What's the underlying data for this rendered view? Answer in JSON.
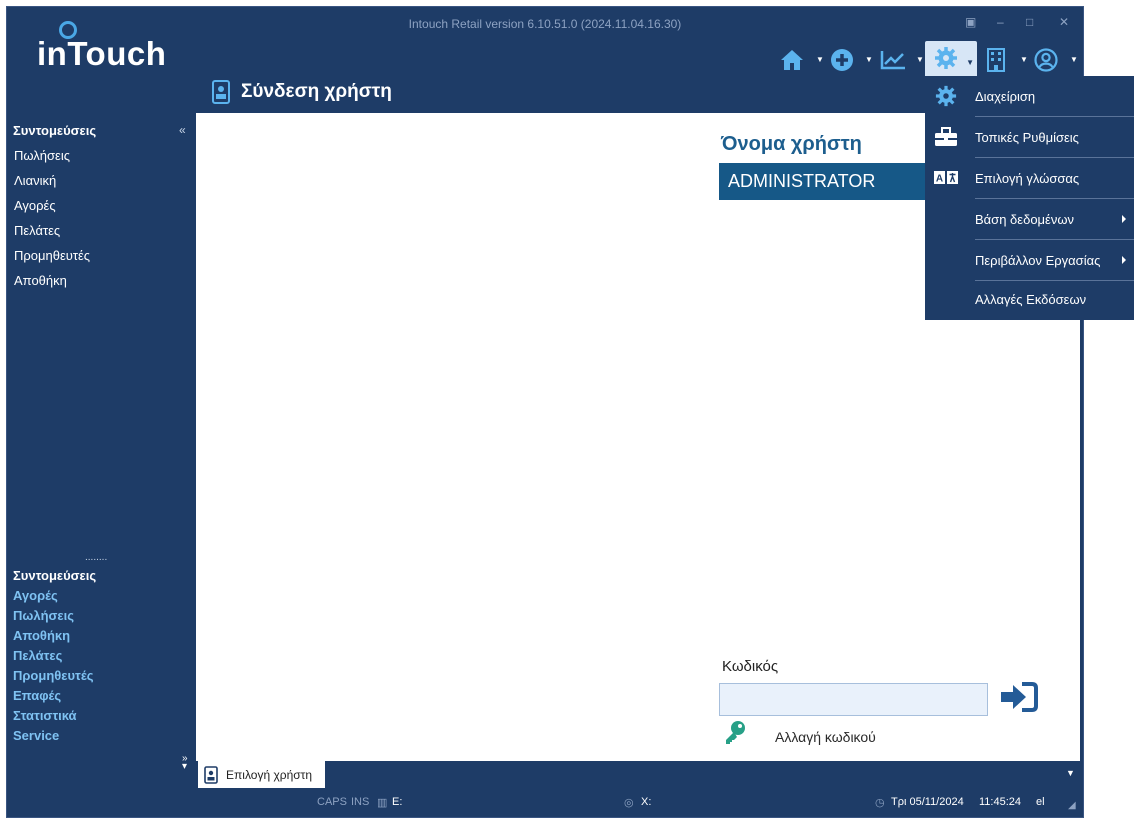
{
  "window": {
    "title": "Intouch Retail version 6.10.51.0 (2024.11.04.16.30)"
  },
  "logo": {
    "text": "inTouch"
  },
  "toolbar": {
    "icons": [
      "home-icon",
      "plus-circle-icon",
      "chart-line-icon",
      "gear-icon",
      "building-icon",
      "user-circle-icon"
    ],
    "active": "gear-icon"
  },
  "page": {
    "title": "Σύνδεση χρήστη"
  },
  "sidebar": {
    "top_heading": "Συντομεύσεις",
    "top_items": [
      "Πωλήσεις",
      "Λιανική",
      "Αγορές",
      "Πελάτες",
      "Προμηθευτές",
      "Αποθήκη"
    ],
    "splitter": "........",
    "bottom_heading": "Συντομεύσεις",
    "bottom_links": [
      "Αγορές",
      "Πωλήσεις",
      "Αποθήκη",
      "Πελάτες",
      "Προμηθευτές",
      "Επαφές",
      "Στατιστικά",
      "Service"
    ]
  },
  "login": {
    "user_label": "Όνομα χρήστη",
    "user_value": "ADMINISTRATOR",
    "password_label": "Κωδικός",
    "password_value": "",
    "change_password": "Αλλαγή κωδικού"
  },
  "bottom_tab": {
    "label": "Επιλογή χρήστη"
  },
  "status": {
    "caps": "CAPS",
    "ins": "INS",
    "drive": "E:",
    "x_label": "X:",
    "date": "Τρι 05/11/2024",
    "time": "11:45:24",
    "lang": "el"
  },
  "menu": {
    "items": [
      {
        "label": "Διαχείριση",
        "icon": "gear-icon",
        "submenu": false
      },
      {
        "label": "Τοπικές Ρυθμίσεις",
        "icon": "toolbox-icon",
        "submenu": false
      },
      {
        "label": "Επιλογή γλώσσας",
        "icon": "language-icon",
        "submenu": false
      },
      {
        "label": "Βάση δεδομένων",
        "icon": "",
        "submenu": true
      },
      {
        "label": "Περιβάλλον Εργασίας",
        "icon": "",
        "submenu": true
      },
      {
        "label": "Αλλαγές Εκδόσεων",
        "icon": "",
        "submenu": false
      }
    ]
  },
  "colors": {
    "frame": "#1e3c67",
    "accent": "#165887",
    "link": "#7fc2f2",
    "highlight": "#d7e6f6"
  }
}
